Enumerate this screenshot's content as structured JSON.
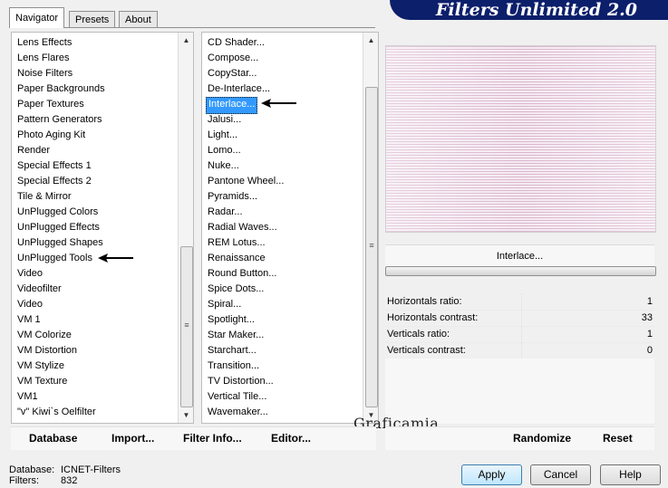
{
  "banner": {
    "title": "Filters Unlimited 2.0"
  },
  "tabs": [
    {
      "label": "Navigator",
      "active": true
    },
    {
      "label": "Presets",
      "active": false
    },
    {
      "label": "About",
      "active": false
    }
  ],
  "categories": [
    "Lens Effects",
    "Lens Flares",
    "Noise Filters",
    "Paper Backgrounds",
    "Paper Textures",
    "Pattern Generators",
    "Photo Aging Kit",
    "Render",
    "Special Effects 1",
    "Special Effects 2",
    "Tile & Mirror",
    "UnPlugged Colors",
    "UnPlugged Effects",
    "UnPlugged Shapes",
    "UnPlugged Tools",
    "Video",
    "Videofilter",
    "Video",
    "VM 1",
    "VM Colorize",
    "VM Distortion",
    "VM Stylize",
    "VM Texture",
    "VM1",
    "\"v\" Kiwi`s Oelfilter"
  ],
  "filters": [
    "CD Shader...",
    "Compose...",
    "CopyStar...",
    "De-Interlace...",
    "Interlace...",
    "Jalusi...",
    "Light...",
    "Lomo...",
    "Nuke...",
    "Pantone Wheel...",
    "Pyramids...",
    "Radar...",
    "Radial Waves...",
    "REM Lotus...",
    "Renaissance",
    "Round Button...",
    "Spice Dots...",
    "Spiral...",
    "Spotlight...",
    "Star Maker...",
    "Starchart...",
    "Transition...",
    "TV Distortion...",
    "Vertical Tile...",
    "Wavemaker..."
  ],
  "selected_filter_index": 4,
  "highlighted_category_index": 14,
  "preview": {
    "filter_name": "Interlace..."
  },
  "params": [
    {
      "name": "Horizontals ratio:",
      "value": "1"
    },
    {
      "name": "Horizontals contrast:",
      "value": "33"
    },
    {
      "name": "Verticals ratio:",
      "value": "1"
    },
    {
      "name": "Verticals contrast:",
      "value": "0"
    }
  ],
  "watermark": "Graficamia",
  "toolbar": {
    "database": "Database",
    "import": "Import...",
    "filter_info": "Filter Info...",
    "editor": "Editor...",
    "randomize": "Randomize",
    "reset": "Reset"
  },
  "footer": {
    "database_label": "Database:",
    "database_value": "ICNET-Filters",
    "filters_label": "Filters:",
    "filters_value": "832",
    "apply": "Apply",
    "cancel": "Cancel",
    "help": "Help"
  }
}
